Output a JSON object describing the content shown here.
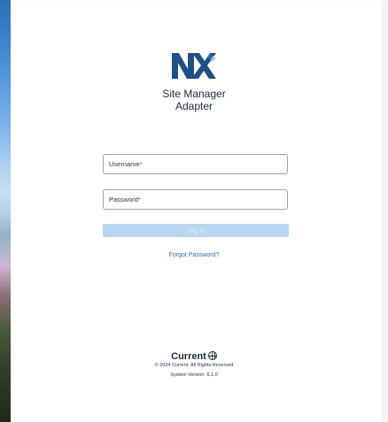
{
  "app": {
    "title_line1": "Site Manager",
    "title_line2": "Adapter"
  },
  "form": {
    "username_label": "Username",
    "password_label": "Password",
    "required_mark": "*",
    "login_label": "Log In",
    "forgot_label": "Forgot Password?"
  },
  "footer": {
    "brand": "Current",
    "copyright": "© 2024 Current. All Rights Reserved",
    "version": "System Version: 6.1.0"
  },
  "colors": {
    "accent": "#2f6fb1",
    "login_disabled": "#b9d6ef",
    "required": "#d23b3b",
    "text_dark": "#1b2a38"
  },
  "icons": [
    "nx-logo-icon",
    "globe-icon"
  ]
}
